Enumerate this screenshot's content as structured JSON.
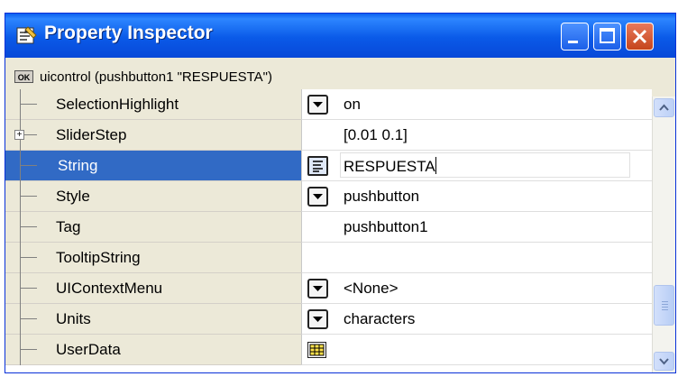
{
  "window": {
    "title": "Property Inspector",
    "object_label": "uicontrol (pushbutton1 \"RESPUESTA\")",
    "ok_icon_text": "OK"
  },
  "colors": {
    "titlebar": "#0a5ae8",
    "selection": "#316ac5",
    "name_column": "#ece9d8"
  },
  "properties": [
    {
      "name": "SelectionHighlight",
      "value": "on",
      "control": "dropdown"
    },
    {
      "name": "SliderStep",
      "value": "[0.01 0.1]",
      "control": "none",
      "expandable": true
    },
    {
      "name": "String",
      "value": "RESPUESTA",
      "control": "text-editor",
      "selected": true,
      "editing": true
    },
    {
      "name": "Style",
      "value": "pushbutton",
      "control": "dropdown"
    },
    {
      "name": "Tag",
      "value": "pushbutton1",
      "control": "none"
    },
    {
      "name": "TooltipString",
      "value": "",
      "control": "none"
    },
    {
      "name": "UIContextMenu",
      "value": "<None>",
      "control": "dropdown"
    },
    {
      "name": "Units",
      "value": "characters",
      "control": "dropdown"
    },
    {
      "name": "UserData",
      "value": "",
      "control": "matrix-editor"
    }
  ],
  "icons": {
    "app": "property-inspector-icon",
    "minimize": "minimize-icon",
    "maximize": "maximize-icon",
    "close": "close-icon",
    "dropdown": "chevron-down-icon",
    "text_editor": "text-editor-icon",
    "matrix_editor": "grid-icon"
  }
}
